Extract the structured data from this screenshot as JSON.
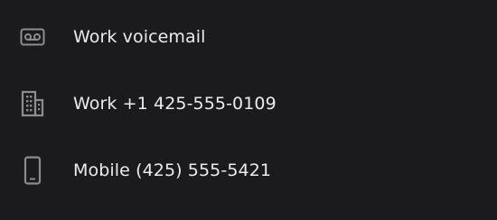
{
  "contact_methods": [
    {
      "icon": "voicemail-icon",
      "label": "Work voicemail"
    },
    {
      "icon": "business-building-icon",
      "label": "Work +1 425-555-0109"
    },
    {
      "icon": "mobile-phone-icon",
      "label": "Mobile (425) 555-5421"
    }
  ],
  "colors": {
    "background": "#1b1a1d",
    "text": "#ececec",
    "icon": "#8d8c8f"
  }
}
